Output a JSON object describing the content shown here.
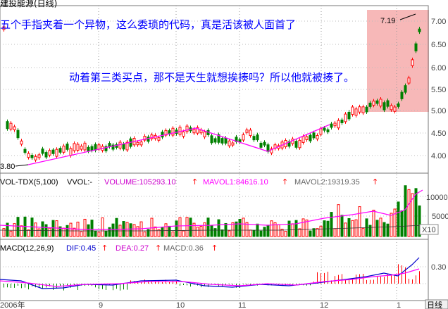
{
  "stock_title": "建投能源(日线)",
  "annotations": {
    "line1": "五个手指夹着一个异物，这么委琐的代码，真是活该被人面首了",
    "line2": "动着第三类买点，那不是天生就想挨揍吗？所以他就被揍了。"
  },
  "price_panel": {
    "axis_labels": [
      "7.00",
      "6.50",
      "6.00",
      "5.50",
      "5.00",
      "4.50",
      "4.00"
    ],
    "low_marker": "3.80",
    "high_marker": "7.19"
  },
  "volume_panel": {
    "indicator": "VOL-TDX(5,100)",
    "vol_label": "VVOL:-",
    "volume": "VOLUME:105293.10",
    "mavol1": "MAVOL1:84616.10",
    "mavol2": "MAVOL2:19319.35",
    "axis_labels": [
      "10000",
      "5000"
    ],
    "unit": "X10"
  },
  "macd_panel": {
    "indicator": "MACD(12,26,9)",
    "dif": "DIF:0.45",
    "dea": "DEA:0.27",
    "macd": "MACD:0.36",
    "axis_label": "0.30"
  },
  "date_axis": [
    "2006年",
    "9",
    "10",
    "11",
    "12",
    "1"
  ],
  "period_button": "日线",
  "colors": {
    "up": "#ff0000",
    "down": "#008000",
    "trend": "#ff00ff",
    "dif_line": "#0000cc",
    "dea_line": "#ff00ff",
    "highlight": "#f4a0a0",
    "annotation_text": "#0000ff",
    "mavol1_color": "#ff00ff",
    "volume_color": "#cc00cc"
  }
}
